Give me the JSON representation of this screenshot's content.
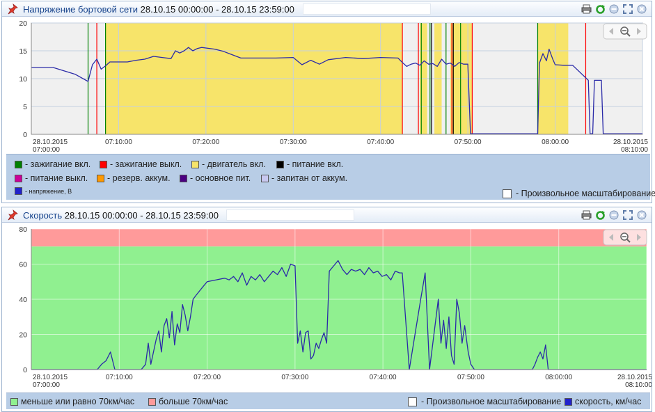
{
  "voltage_panel": {
    "title": "Напряжение бортовой сети",
    "range": "28.10.15 00:00:00 - 28.10.15 23:59:00",
    "legend": [
      {
        "label": "- зажигание вкл.",
        "color": "#008000"
      },
      {
        "label": "- зажигание выкл.",
        "color": "#ff0000"
      },
      {
        "label": "- двигатель вкл.",
        "color": "#f7e46a"
      },
      {
        "label": "- питание вкл.",
        "color": "#000000"
      },
      {
        "label": "- питание выкл.",
        "color": "#cc0099"
      },
      {
        "label": "- резерв. аккум.",
        "color": "#ff9900"
      },
      {
        "label": "- основное пит.",
        "color": "#4b0082"
      },
      {
        "label": "- запитан от аккум.",
        "color": "#c8c8f0"
      },
      {
        "label": "- напряжение, В",
        "color": "#2222cc"
      }
    ],
    "custom_scale": "- Произвольное масштабирование"
  },
  "speed_panel": {
    "title": "Скорость",
    "range": "28.10.15 00:00:00 - 28.10.15 23:59:00",
    "legend": [
      {
        "label": "меньше или равно 70км/час",
        "color": "#90f090"
      },
      {
        "label": "больше 70км/час",
        "color": "#ff9a9a"
      },
      {
        "label": "скорость, км/час",
        "color": "#2222cc"
      }
    ],
    "custom_scale": "- Произвольное масштабирование"
  },
  "x_ticks": [
    {
      "m": 0,
      "l1": "28.10.2015",
      "l2": "07:00:00"
    },
    {
      "m": 10,
      "l1": "07:10:00"
    },
    {
      "m": 20,
      "l1": "07:20:00"
    },
    {
      "m": 30,
      "l1": "07:30:00"
    },
    {
      "m": 40,
      "l1": "07:40:00"
    },
    {
      "m": 50,
      "l1": "07:50:00"
    },
    {
      "m": 60,
      "l1": "08:00:00"
    },
    {
      "m": 70,
      "l1": "28.10.2015",
      "l2": "08:10:00"
    }
  ],
  "chart_data": [
    {
      "type": "line",
      "ylim": [
        0,
        20
      ],
      "yticks": [
        0,
        5,
        10,
        15,
        20
      ],
      "xlim": [
        "07:00:00",
        "08:10:00"
      ],
      "engine_on_bands": [
        [
          "07:08:30",
          "07:42:30"
        ],
        [
          "07:44:30",
          "07:45:20"
        ],
        [
          "07:46:10",
          "07:47:00"
        ],
        [
          "07:48:00",
          "07:50:30"
        ],
        [
          "07:58:00",
          "08:01:30"
        ]
      ],
      "markers": [
        {
          "t": "07:06:30",
          "kind": "зажигание вкл."
        },
        {
          "t": "07:07:30",
          "kind": "зажигание выкл."
        },
        {
          "t": "07:08:30",
          "kind": "зажигание вкл."
        },
        {
          "t": "07:42:30",
          "kind": "зажигание выкл."
        },
        {
          "t": "07:44:20",
          "kind": "зажигание выкл."
        },
        {
          "t": "07:44:40",
          "kind": "зажигание вкл."
        },
        {
          "t": "07:45:40",
          "kind": "зажигание вкл."
        },
        {
          "t": "07:45:50",
          "kind": "питание вкл."
        },
        {
          "t": "07:47:30",
          "kind": "зажигание вкл."
        },
        {
          "t": "07:48:10",
          "kind": "зажигание выкл."
        },
        {
          "t": "07:48:20",
          "kind": "питание вкл."
        },
        {
          "t": "07:49:10",
          "kind": "зажигание вкл."
        },
        {
          "t": "07:50:30",
          "kind": "зажигание выкл."
        },
        {
          "t": "07:58:00",
          "kind": "зажигание вкл."
        },
        {
          "t": "08:03:30",
          "kind": "зажигание выкл."
        }
      ],
      "series": [
        {
          "name": "напряжение, В",
          "points": [
            [
              0,
              12
            ],
            [
              2.5,
              12
            ],
            [
              5,
              10.8
            ],
            [
              6.5,
              9.5
            ],
            [
              7,
              12.5
            ],
            [
              7.5,
              13.5
            ],
            [
              8,
              11.7
            ],
            [
              8.5,
              12.3
            ],
            [
              9,
              13
            ],
            [
              11,
              13
            ],
            [
              12,
              13.3
            ],
            [
              13,
              13.5
            ],
            [
              14,
              14
            ],
            [
              15,
              13.8
            ],
            [
              16,
              13.6
            ],
            [
              16.5,
              15
            ],
            [
              17,
              14.6
            ],
            [
              17.5,
              15
            ],
            [
              18,
              15.6
            ],
            [
              18.5,
              15
            ],
            [
              19,
              15.4
            ],
            [
              19.5,
              15.6
            ],
            [
              20,
              15.5
            ],
            [
              21,
              15.3
            ],
            [
              22,
              14.9
            ],
            [
              23,
              14.3
            ],
            [
              24,
              13.7
            ],
            [
              26,
              13.7
            ],
            [
              28,
              13.7
            ],
            [
              30,
              13.8
            ],
            [
              31,
              12.5
            ],
            [
              32,
              13.3
            ],
            [
              33,
              12.6
            ],
            [
              34,
              13.4
            ],
            [
              36,
              13.8
            ],
            [
              38,
              13.6
            ],
            [
              40,
              13.8
            ],
            [
              42,
              13.7
            ],
            [
              42.5,
              12.9
            ],
            [
              43,
              12.2
            ],
            [
              43.5,
              12.6
            ],
            [
              44,
              12.8
            ],
            [
              44.5,
              12.4
            ],
            [
              45,
              13.2
            ],
            [
              45.5,
              12.6
            ],
            [
              46,
              12.7
            ],
            [
              46.5,
              12.2
            ],
            [
              47,
              13.5
            ],
            [
              47.5,
              12.6
            ],
            [
              48,
              12.8
            ],
            [
              48.5,
              12.2
            ],
            [
              49,
              12.9
            ],
            [
              49.5,
              12.6
            ],
            [
              50,
              12.6
            ],
            [
              50.3,
              0.1
            ],
            [
              58,
              0.1
            ],
            [
              58.2,
              12.8
            ],
            [
              58.6,
              14.5
            ],
            [
              59,
              13.2
            ],
            [
              59.3,
              15.3
            ],
            [
              59.7,
              13.6
            ],
            [
              60,
              12.5
            ],
            [
              61,
              12.4
            ],
            [
              62,
              12.4
            ],
            [
              63.8,
              9.7
            ],
            [
              64,
              0.1
            ],
            [
              64.3,
              0.1
            ],
            [
              64.5,
              9.7
            ],
            [
              65.3,
              9.7
            ],
            [
              65.5,
              0.1
            ],
            [
              70,
              0.1
            ]
          ]
        }
      ]
    },
    {
      "type": "line",
      "ylim": [
        0,
        80
      ],
      "yticks": [
        0,
        20,
        40,
        60,
        80
      ],
      "threshold": 70,
      "xlim": [
        "07:00:00",
        "08:10:00"
      ],
      "series": [
        {
          "name": "скорость, км/час",
          "points": [
            [
              0,
              0
            ],
            [
              7.5,
              0
            ],
            [
              8,
              3
            ],
            [
              8.5,
              5
            ],
            [
              9,
              10
            ],
            [
              9.5,
              0
            ],
            [
              12.5,
              0
            ],
            [
              13,
              3
            ],
            [
              13.3,
              15
            ],
            [
              13.6,
              3
            ],
            [
              13.9,
              10
            ],
            [
              14.2,
              17
            ],
            [
              14.5,
              22
            ],
            [
              14.8,
              10
            ],
            [
              15.1,
              25
            ],
            [
              15.4,
              29
            ],
            [
              15.7,
              18
            ],
            [
              16,
              33
            ],
            [
              16.3,
              14
            ],
            [
              16.6,
              26
            ],
            [
              16.9,
              21
            ],
            [
              17.2,
              37
            ],
            [
              17.5,
              31
            ],
            [
              17.8,
              22
            ],
            [
              18.1,
              30
            ],
            [
              18.4,
              40
            ],
            [
              18.7,
              42
            ],
            [
              19.5,
              47
            ],
            [
              20,
              50
            ],
            [
              21,
              51
            ],
            [
              22,
              52
            ],
            [
              22.5,
              51
            ],
            [
              23,
              53
            ],
            [
              23.5,
              50
            ],
            [
              24,
              55
            ],
            [
              24.5,
              48
            ],
            [
              25,
              53
            ],
            [
              25.5,
              51
            ],
            [
              26,
              54
            ],
            [
              26.5,
              50
            ],
            [
              27,
              53
            ],
            [
              27.5,
              56
            ],
            [
              28,
              54
            ],
            [
              28.5,
              58
            ],
            [
              29,
              53
            ],
            [
              29.5,
              60
            ],
            [
              30,
              59
            ],
            [
              30.3,
              15
            ],
            [
              30.6,
              22
            ],
            [
              30.9,
              10
            ],
            [
              31.2,
              21
            ],
            [
              31.5,
              22
            ],
            [
              31.8,
              6
            ],
            [
              32.1,
              8
            ],
            [
              32.4,
              15
            ],
            [
              32.7,
              12
            ],
            [
              33,
              17
            ],
            [
              33.3,
              21
            ],
            [
              33.6,
              15
            ],
            [
              33.9,
              56
            ],
            [
              34.4,
              59
            ],
            [
              34.9,
              62
            ],
            [
              35.4,
              57
            ],
            [
              35.9,
              54
            ],
            [
              36.4,
              57
            ],
            [
              36.9,
              56
            ],
            [
              37.4,
              57
            ],
            [
              37.9,
              54
            ],
            [
              38.4,
              58
            ],
            [
              38.9,
              55
            ],
            [
              39.4,
              56
            ],
            [
              39.9,
              53
            ],
            [
              40.4,
              54
            ],
            [
              40.9,
              51
            ],
            [
              41.4,
              56
            ],
            [
              41.9,
              55
            ],
            [
              42.2,
              55
            ],
            [
              43,
              0
            ],
            [
              44.3,
              40
            ],
            [
              44.8,
              55
            ],
            [
              45.3,
              0
            ],
            [
              46.3,
              40
            ],
            [
              46.6,
              15
            ],
            [
              46.9,
              28
            ],
            [
              47.2,
              12
            ],
            [
              47.5,
              30
            ],
            [
              47.8,
              8
            ],
            [
              48.1,
              3
            ],
            [
              48.4,
              40
            ],
            [
              48.7,
              32
            ],
            [
              49,
              15
            ],
            [
              49.3,
              25
            ],
            [
              49.7,
              10
            ],
            [
              50,
              3
            ],
            [
              50.4,
              0
            ],
            [
              57,
              0
            ],
            [
              57.3,
              3
            ],
            [
              57.6,
              7
            ],
            [
              57.9,
              10
            ],
            [
              58.2,
              6
            ],
            [
              58.5,
              14
            ],
            [
              58.8,
              0
            ],
            [
              70,
              0
            ]
          ]
        }
      ]
    }
  ]
}
